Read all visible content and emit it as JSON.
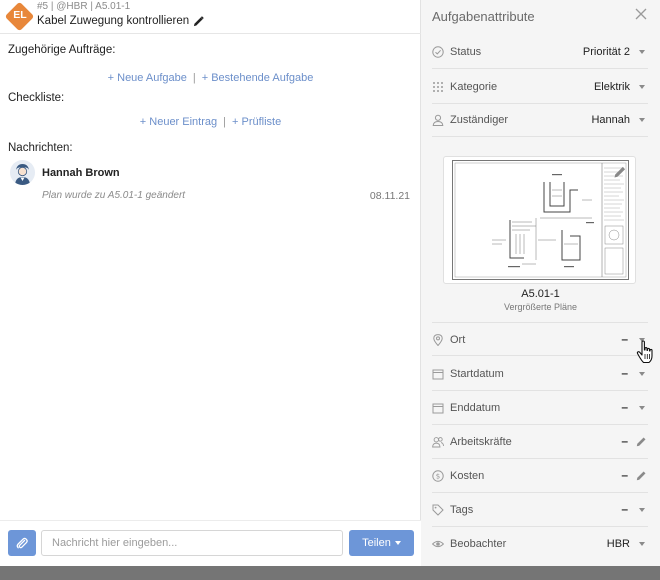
{
  "header": {
    "badge": "EL",
    "ident": "#5 | @HBR | A5.01-1",
    "title": "Kabel Zuwegung kontrollieren"
  },
  "sections": {
    "related_label": "Zugehörige Aufträge:",
    "related_new": "+ Neue Aufgabe",
    "related_existing": "+ Bestehende Aufgabe",
    "checklist_label": "Checkliste:",
    "checklist_new": "+ Neuer Eintrag",
    "checklist_test": "+ Prüfliste",
    "messages_label": "Nachrichten:",
    "separator": "|"
  },
  "message": {
    "author": "Hannah Brown",
    "text": "Plan wurde zu A5.01-1 geändert",
    "date": "08.11.21"
  },
  "composer": {
    "placeholder": "Nachricht hier eingeben...",
    "share_label": "Teilen"
  },
  "attributes": {
    "title": "Aufgabenattribute",
    "status": {
      "label": "Status",
      "value": "Priorität 2",
      "icon": "check-circle-icon"
    },
    "category": {
      "label": "Kategorie",
      "value": "Elektrik",
      "icon": "grid-dots-icon"
    },
    "assignee": {
      "label": "Zuständiger",
      "value": "Hannah",
      "icon": "person-icon"
    },
    "plan": {
      "name": "A5.01-1",
      "subtitle": "Vergrößerte Pläne"
    },
    "location": {
      "label": "Ort",
      "value": "–",
      "icon": "pin-icon"
    },
    "start": {
      "label": "Startdatum",
      "value": "–",
      "icon": "calendar-icon"
    },
    "end": {
      "label": "Enddatum",
      "value": "–",
      "icon": "calendar-icon"
    },
    "workers": {
      "label": "Arbeitskräfte",
      "value": "–",
      "icon": "people-icon"
    },
    "costs": {
      "label": "Kosten",
      "value": "–",
      "icon": "dollar-circle-icon"
    },
    "tags": {
      "label": "Tags",
      "value": "–",
      "icon": "tag-icon"
    },
    "observers": {
      "label": "Beobachter",
      "value": "HBR",
      "icon": "eye-icon"
    }
  },
  "colors": {
    "accent": "#6d96d8",
    "link": "#6c8fca",
    "badge": "#e8873a",
    "panel_bg": "#f5f5f5"
  }
}
